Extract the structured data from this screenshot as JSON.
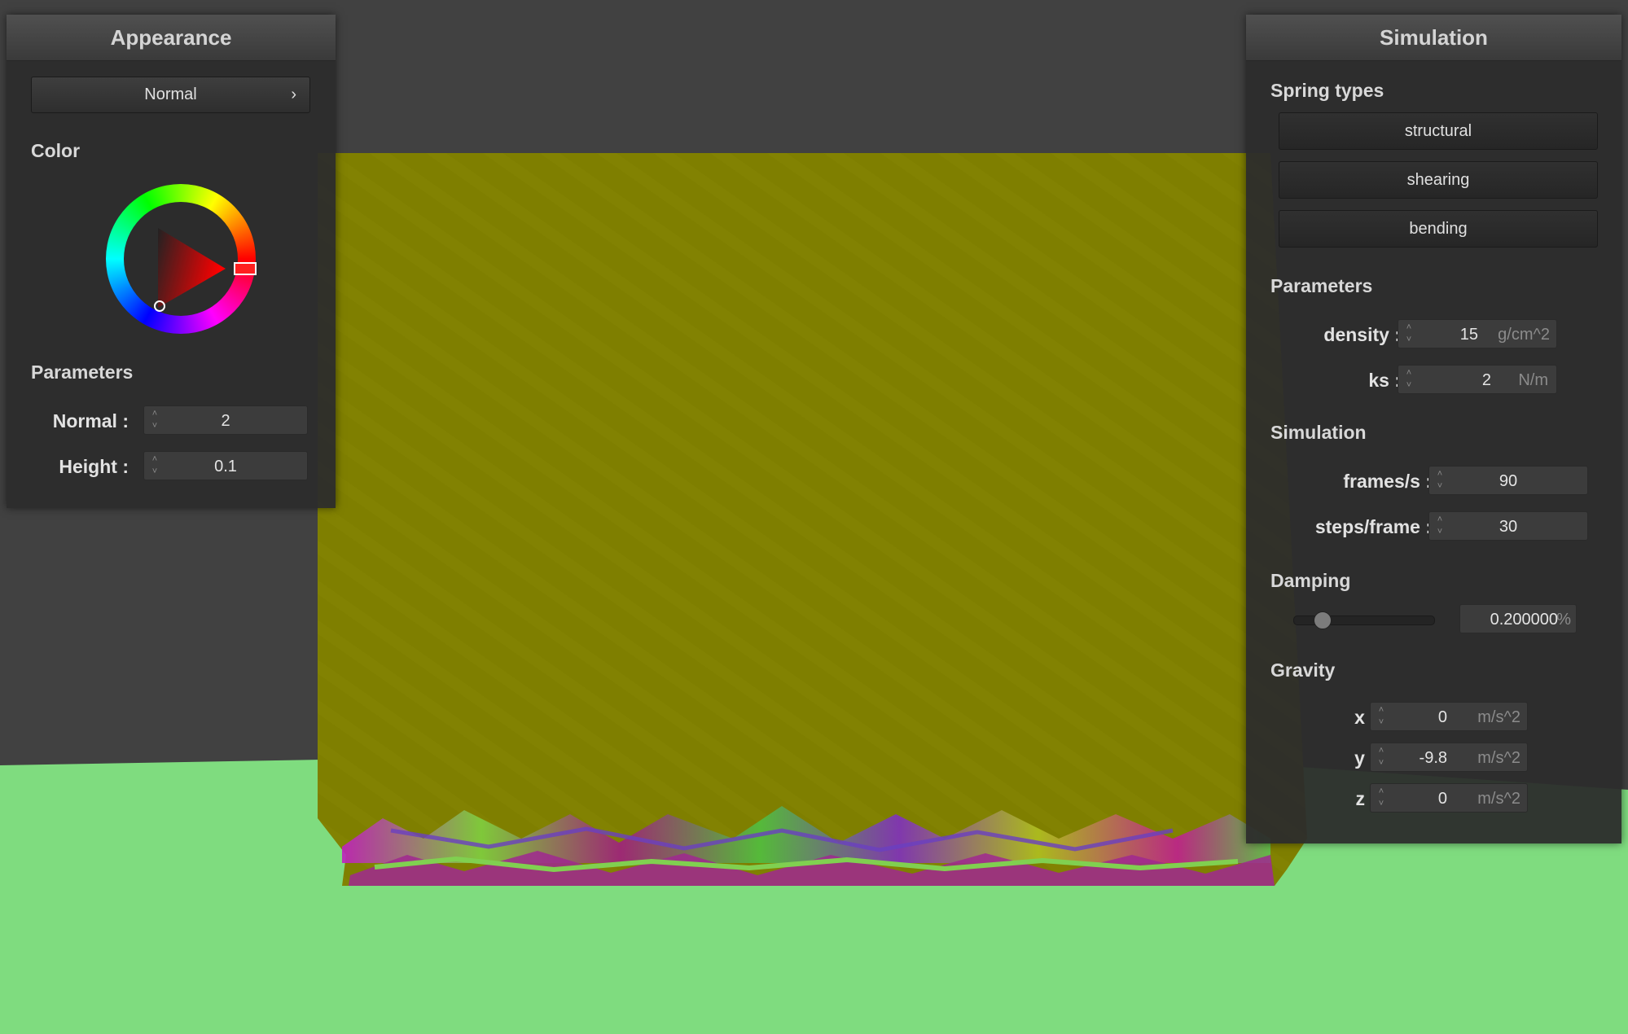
{
  "appearance": {
    "title": "Appearance",
    "mode_button": "Normal",
    "color_label": "Color",
    "parameters_label": "Parameters",
    "normal": {
      "label": "Normal :",
      "value": "2"
    },
    "height": {
      "label": "Height :",
      "value": "0.1"
    },
    "selected_hue": "#ff0000"
  },
  "simulation": {
    "title": "Simulation",
    "spring_types_label": "Spring types",
    "spring_types": [
      "structural",
      "shearing",
      "bending"
    ],
    "parameters_label": "Parameters",
    "density": {
      "label": "density :",
      "value": "15",
      "unit": "g/cm^2"
    },
    "ks": {
      "label": "ks :",
      "value": "2",
      "unit": "N/m"
    },
    "simulation_label": "Simulation",
    "fps": {
      "label": "frames/s :",
      "value": "90"
    },
    "steps": {
      "label": "steps/frame :",
      "value": "30"
    },
    "damping_label": "Damping",
    "damping": {
      "value": "0.200000",
      "unit": "%",
      "level": 0.2
    },
    "gravity_label": "Gravity",
    "gravity": [
      {
        "label": "x :",
        "value": "0",
        "unit": "m/s^2"
      },
      {
        "label": "y :",
        "value": "-9.8",
        "unit": "m/s^2"
      },
      {
        "label": "z :",
        "value": "0",
        "unit": "m/s^2"
      }
    ]
  },
  "colors": {
    "background": "#414141",
    "ground": "#7fdc7f",
    "cloth": "#7f7f00"
  }
}
